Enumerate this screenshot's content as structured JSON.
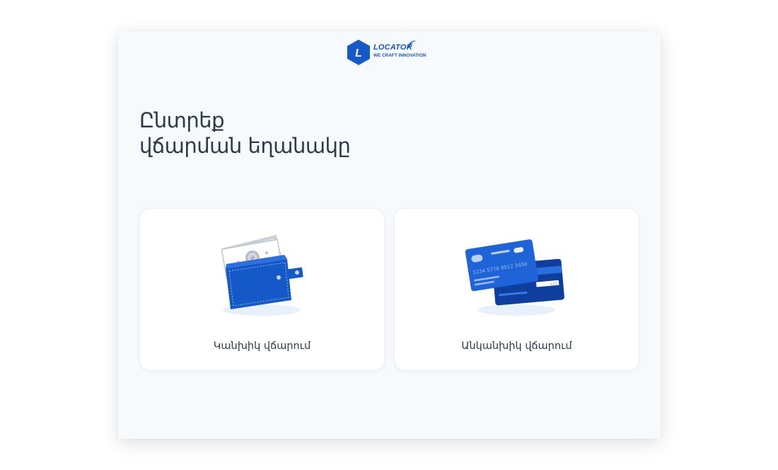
{
  "logo": {
    "brand": "LOCATOR",
    "tagline": "WE CRAFT INNOVATION",
    "letter": "L",
    "color": "#1559c9"
  },
  "heading": {
    "line1": "Ընտրեք",
    "line2": "վճարման եղանակը"
  },
  "options": [
    {
      "label": "Կանխիկ վճարում",
      "icon": "wallet-icon"
    },
    {
      "label": "Անկանխիկ վճարում",
      "icon": "credit-cards-icon",
      "card_number": "1234  5778  9012  3456",
      "cvv": "123"
    }
  ],
  "colors": {
    "accent": "#1559c9",
    "text": "#2b3a4d",
    "background": "#f7fafc"
  }
}
